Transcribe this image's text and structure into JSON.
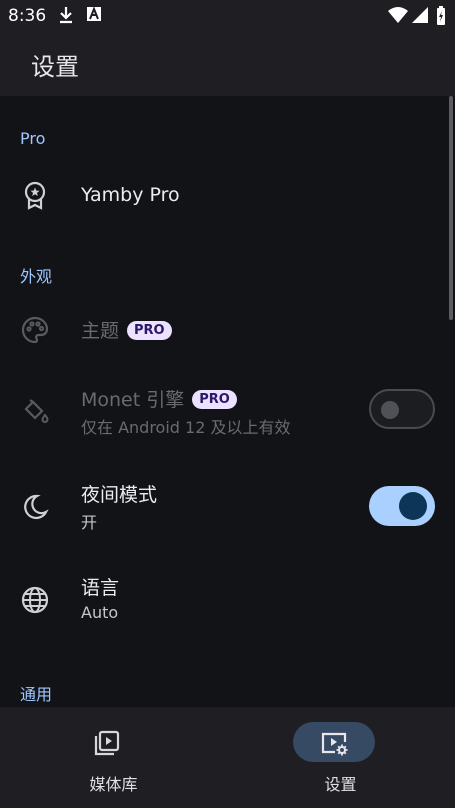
{
  "status_bar": {
    "time": "8:36"
  },
  "app_bar": {
    "title": "设置"
  },
  "sections": {
    "pro": {
      "header": "Pro",
      "items": [
        {
          "title": "Yamby Pro",
          "icon": "award-badge-icon"
        }
      ]
    },
    "appearance": {
      "header": "外观",
      "items": [
        {
          "title": "主题",
          "badge": "PRO",
          "icon": "palette-icon",
          "enabled": false
        },
        {
          "title": "Monet 引擎",
          "badge": "PRO",
          "subtitle": "仅在 Android 12 及以上有效",
          "icon": "paint-bucket-icon",
          "enabled": false,
          "toggle": false
        },
        {
          "title": "夜间模式",
          "subtitle": "开",
          "icon": "moon-icon",
          "enabled": true,
          "toggle": true
        },
        {
          "title": "语言",
          "subtitle": "Auto",
          "icon": "globe-icon",
          "enabled": true
        }
      ]
    },
    "general": {
      "header": "通用"
    }
  },
  "bottom_nav": {
    "items": [
      {
        "label": "媒体库",
        "icon": "media-library-icon",
        "active": false
      },
      {
        "label": "设置",
        "icon": "settings-video-icon",
        "active": true
      }
    ]
  },
  "colors": {
    "accent": "#9ec7ff",
    "toggle_on_track": "#a9d0ff",
    "toggle_on_knob": "#0d3557",
    "badge_bg": "#ece1ff",
    "background": "#121316",
    "surface": "#1f1f23"
  }
}
